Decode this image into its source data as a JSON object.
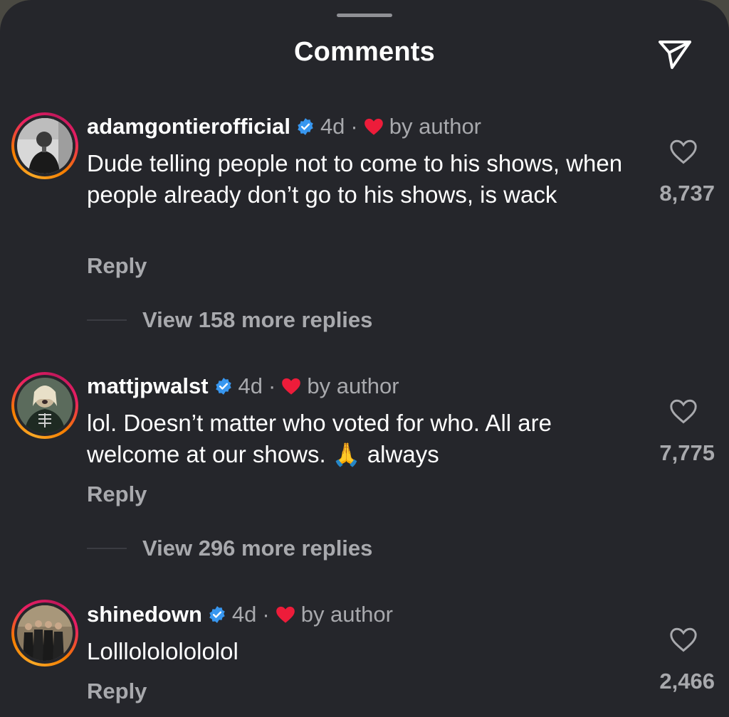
{
  "header": {
    "title": "Comments",
    "share_icon": "paper-plane-icon"
  },
  "comments": [
    {
      "username": "adamgontierofficial",
      "time": "4d",
      "separator": "·",
      "author_like": "by author",
      "text": "Dude telling people not to come to his shows, when people already don’t go to his shows, is wack",
      "reply_label": "Reply",
      "likes": "8,737",
      "view_replies": "View 158 more replies"
    },
    {
      "username": "mattjpwalst",
      "time": "4d",
      "separator": "·",
      "author_like": "by author",
      "text_before": "lol. Doesn’t matter who voted for who. All are welcome at our shows.",
      "emoji": "🙏",
      "text_after": "always",
      "reply_label": "Reply",
      "likes": "7,775",
      "view_replies": "View 296 more replies"
    },
    {
      "username": "shinedown",
      "time": "4d",
      "separator": "·",
      "author_like": "by author",
      "text": "Lolllolololololol",
      "reply_label": "Reply",
      "likes": "2,466"
    }
  ],
  "colors": {
    "background": "#25262b",
    "text_primary": "#ffffff",
    "text_secondary": "#a8a9ad",
    "verified_blue": "#3897f0",
    "heart_red": "#ed1c3a"
  }
}
